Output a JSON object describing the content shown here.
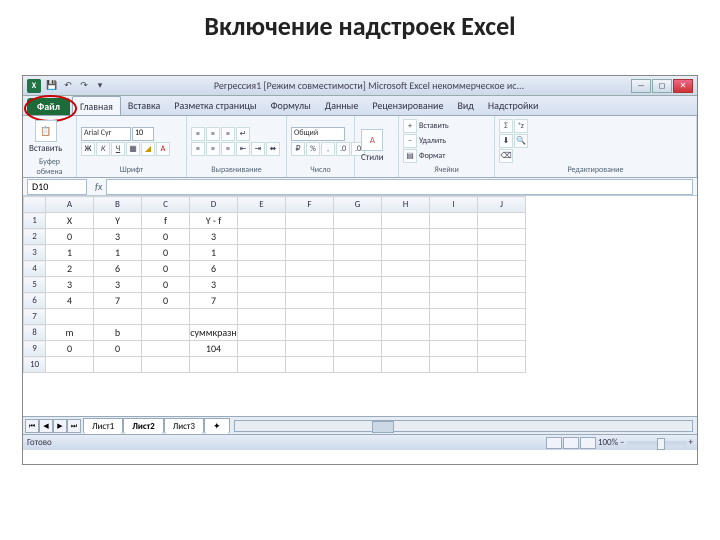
{
  "slide": {
    "title": "Включение надстроек Excel"
  },
  "window": {
    "title": "Регрессия1  [Режим совместимости]   Microsoft Excel некоммерческое ис...",
    "tabs": {
      "file": "Файл",
      "home": "Главная",
      "insert": "Вставка",
      "layout": "Разметка страницы",
      "formulas": "Формулы",
      "data": "Данные",
      "review": "Рецензирование",
      "view": "Вид",
      "addins": "Надстройки"
    },
    "groups": {
      "clipboard": "Буфер обмена",
      "font": "Шрифт",
      "align": "Выравнивание",
      "number": "Число",
      "styles": "Стили",
      "cells": "Ячейки",
      "editing": "Редактирование"
    },
    "font": {
      "name": "Arial Cyr",
      "size": "10"
    },
    "cellsMenu": {
      "insert": "Вставить",
      "delete": "Удалить",
      "format": "Формат"
    },
    "numberFormat": "Общий",
    "paste": "Вставить",
    "styles": "Стили",
    "namebox": "D10",
    "cols": [
      "A",
      "B",
      "C",
      "D",
      "E",
      "F",
      "G",
      "H",
      "I",
      "J"
    ],
    "rows": [
      {
        "n": "1",
        "c": [
          "X",
          "Y",
          "f",
          "Y - f",
          "",
          "",
          "",
          "",
          "",
          ""
        ]
      },
      {
        "n": "2",
        "c": [
          "0",
          "3",
          "0",
          "3",
          "",
          "",
          "",
          "",
          "",
          ""
        ]
      },
      {
        "n": "3",
        "c": [
          "1",
          "1",
          "0",
          "1",
          "",
          "",
          "",
          "",
          "",
          ""
        ]
      },
      {
        "n": "4",
        "c": [
          "2",
          "6",
          "0",
          "6",
          "",
          "",
          "",
          "",
          "",
          ""
        ]
      },
      {
        "n": "5",
        "c": [
          "3",
          "3",
          "0",
          "3",
          "",
          "",
          "",
          "",
          "",
          ""
        ]
      },
      {
        "n": "6",
        "c": [
          "4",
          "7",
          "0",
          "7",
          "",
          "",
          "",
          "",
          "",
          ""
        ]
      },
      {
        "n": "7",
        "c": [
          "",
          "",
          "",
          "",
          "",
          "",
          "",
          "",
          "",
          ""
        ]
      },
      {
        "n": "8",
        "c": [
          "m",
          "b",
          "",
          "суммкразн",
          "",
          "",
          "",
          "",
          "",
          ""
        ]
      },
      {
        "n": "9",
        "c": [
          "0",
          "0",
          "",
          "104",
          "",
          "",
          "",
          "",
          "",
          ""
        ]
      },
      {
        "n": "10",
        "c": [
          "",
          "",
          "",
          "",
          "",
          "",
          "",
          "",
          "",
          ""
        ]
      }
    ],
    "sheets": {
      "s1": "Лист1",
      "s2": "Лист2",
      "s3": "Лист3"
    },
    "status": "Готово",
    "zoom": "100%"
  }
}
